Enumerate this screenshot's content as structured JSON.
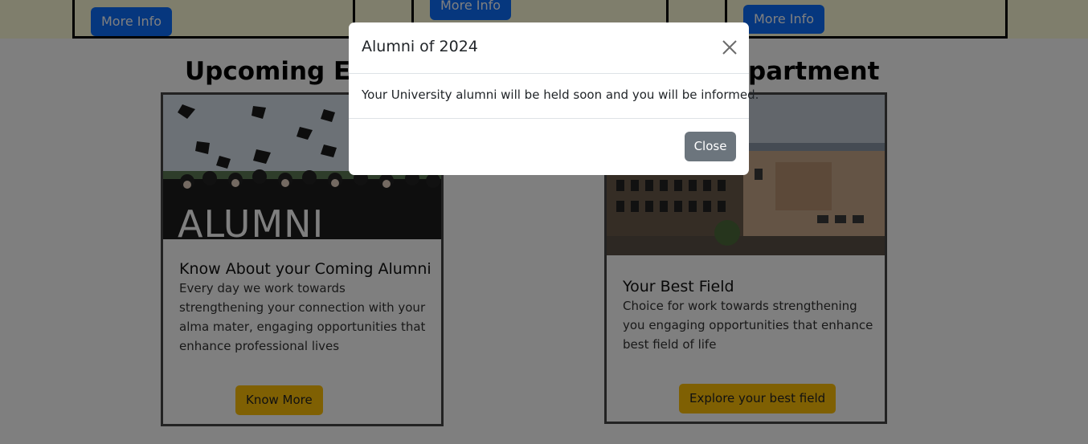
{
  "top_cards": {
    "buttons": [
      "More Info",
      "More Info",
      "More Info"
    ]
  },
  "sections": {
    "left_title": "Upcoming Eve",
    "right_title": "partment"
  },
  "cards": [
    {
      "image_caption": "ALUMNI",
      "title": "Know About your Coming Alumni",
      "text": "Every day we work towards strengthening your connection with your alma mater, engaging opportunities that enhance professional lives",
      "button": "Know More"
    },
    {
      "title": "Your Best Field",
      "text": "Choice for work towards strengthening you engaging opportunities that enhance best field of life",
      "button": "Explore your best field"
    }
  ],
  "modal": {
    "title": "Alumni of 2024",
    "body": "Your University alumni will be held soon and you will be informed.",
    "close_label": "Close"
  },
  "colors": {
    "primary": "#0d6efd",
    "warning": "#ffc107",
    "secondary": "#6c757d",
    "strip": "#fffdd8"
  }
}
